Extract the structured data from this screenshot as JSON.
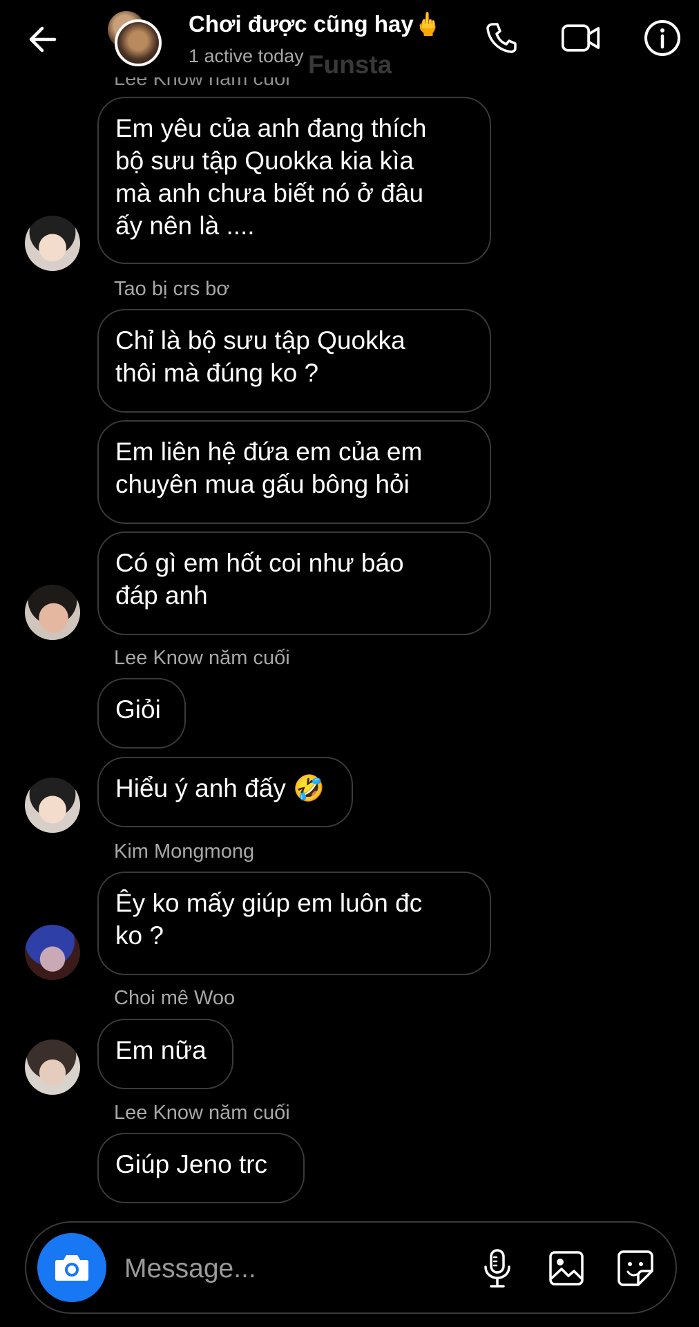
{
  "header": {
    "title": "Chơi được cũng hay🖕",
    "status": "1 active today",
    "watermark": "Funsta",
    "top_cut_sender": "Lee Know năm cuối"
  },
  "messages": [
    {
      "sender": "",
      "lines": [
        "Em yêu của anh đang thích",
        "bộ sưu tập Quokka kia kìa",
        "mà anh chưa biết nó ở đâu",
        "ấy nên là ...."
      ],
      "avatar": "lee-know"
    },
    {
      "sender": "Tao bị crs bơ",
      "lines": [
        "Chỉ là bộ sưu tập Quokka",
        "thôi mà đúng ko ?"
      ]
    },
    {
      "lines": [
        "Em liên hệ đứa em của em",
        "chuyên mua gấu bông hỏi"
      ]
    },
    {
      "lines": [
        "Có gì em hốt coi như báo",
        "đáp anh"
      ],
      "avatar": "tao"
    },
    {
      "sender": "Lee Know năm cuối",
      "lines": [
        "Giỏi"
      ]
    },
    {
      "lines": [
        "Hiểu ý anh đấy 🤣"
      ],
      "avatar": "lee-know"
    },
    {
      "sender": "Kim Mongmong",
      "lines": [
        "Êy ko mấy giúp em luôn đc",
        "ko ?"
      ],
      "avatar": "kim"
    },
    {
      "sender": "Choi mê Woo",
      "lines": [
        "Em nữa"
      ],
      "avatar": "choi"
    },
    {
      "sender": "Lee Know năm cuối",
      "lines": [
        "Giúp Jeno trc"
      ]
    }
  ],
  "composer": {
    "placeholder": "Message..."
  },
  "icons": {
    "back": "arrow-left-icon",
    "call": "phone-icon",
    "video": "video-camera-icon",
    "info": "info-icon",
    "camera": "camera-icon",
    "mic": "microphone-icon",
    "gallery": "image-icon",
    "sticker": "sticker-icon"
  },
  "colors": {
    "background": "#000000",
    "bubble_border": "#3a3a3a",
    "secondary_text": "#a8a8a8",
    "camera_button": "#1877f2"
  }
}
